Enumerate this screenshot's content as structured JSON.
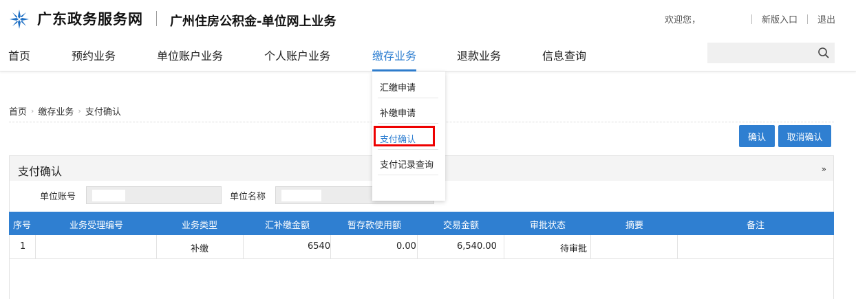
{
  "header": {
    "brand": "广东政务服务网",
    "subtitle": "广州住房公积金-单位网上业务",
    "welcome": "欢迎您，",
    "new_version": "新版入口",
    "logout": "退出"
  },
  "nav": {
    "items": [
      "首页",
      "预约业务",
      "单位账户业务",
      "个人账户业务",
      "缴存业务",
      "退款业务",
      "信息查询"
    ],
    "active_index": 4
  },
  "dropdown": {
    "items": [
      "汇缴申请",
      "补缴申请",
      "支付确认",
      "支付记录查询"
    ],
    "active_index": 2
  },
  "breadcrumb": [
    "首页",
    "缴存业务",
    "支付确认"
  ],
  "buttons": {
    "confirm": "确认",
    "cancel_confirm": "取消确认"
  },
  "panel": {
    "title": "支付确认",
    "unit_account_label": "单位账号",
    "unit_name_label": "单位名称"
  },
  "table": {
    "headers": [
      "序号",
      "业务受理编号",
      "业务类型",
      "汇补缴金额",
      "暂存款使用额",
      "交易金额",
      "审批状态",
      "摘要",
      "备注"
    ],
    "rows": [
      {
        "seq": "1",
        "accept_no": "",
        "type": "补缴",
        "amount": "6540",
        "temp_used": "0.00",
        "trade_amount": "6,540.00",
        "status": "待审批",
        "summary": "",
        "remark": ""
      }
    ]
  },
  "colors": {
    "accent": "#2f7fd1",
    "highlight": "#e00000"
  }
}
